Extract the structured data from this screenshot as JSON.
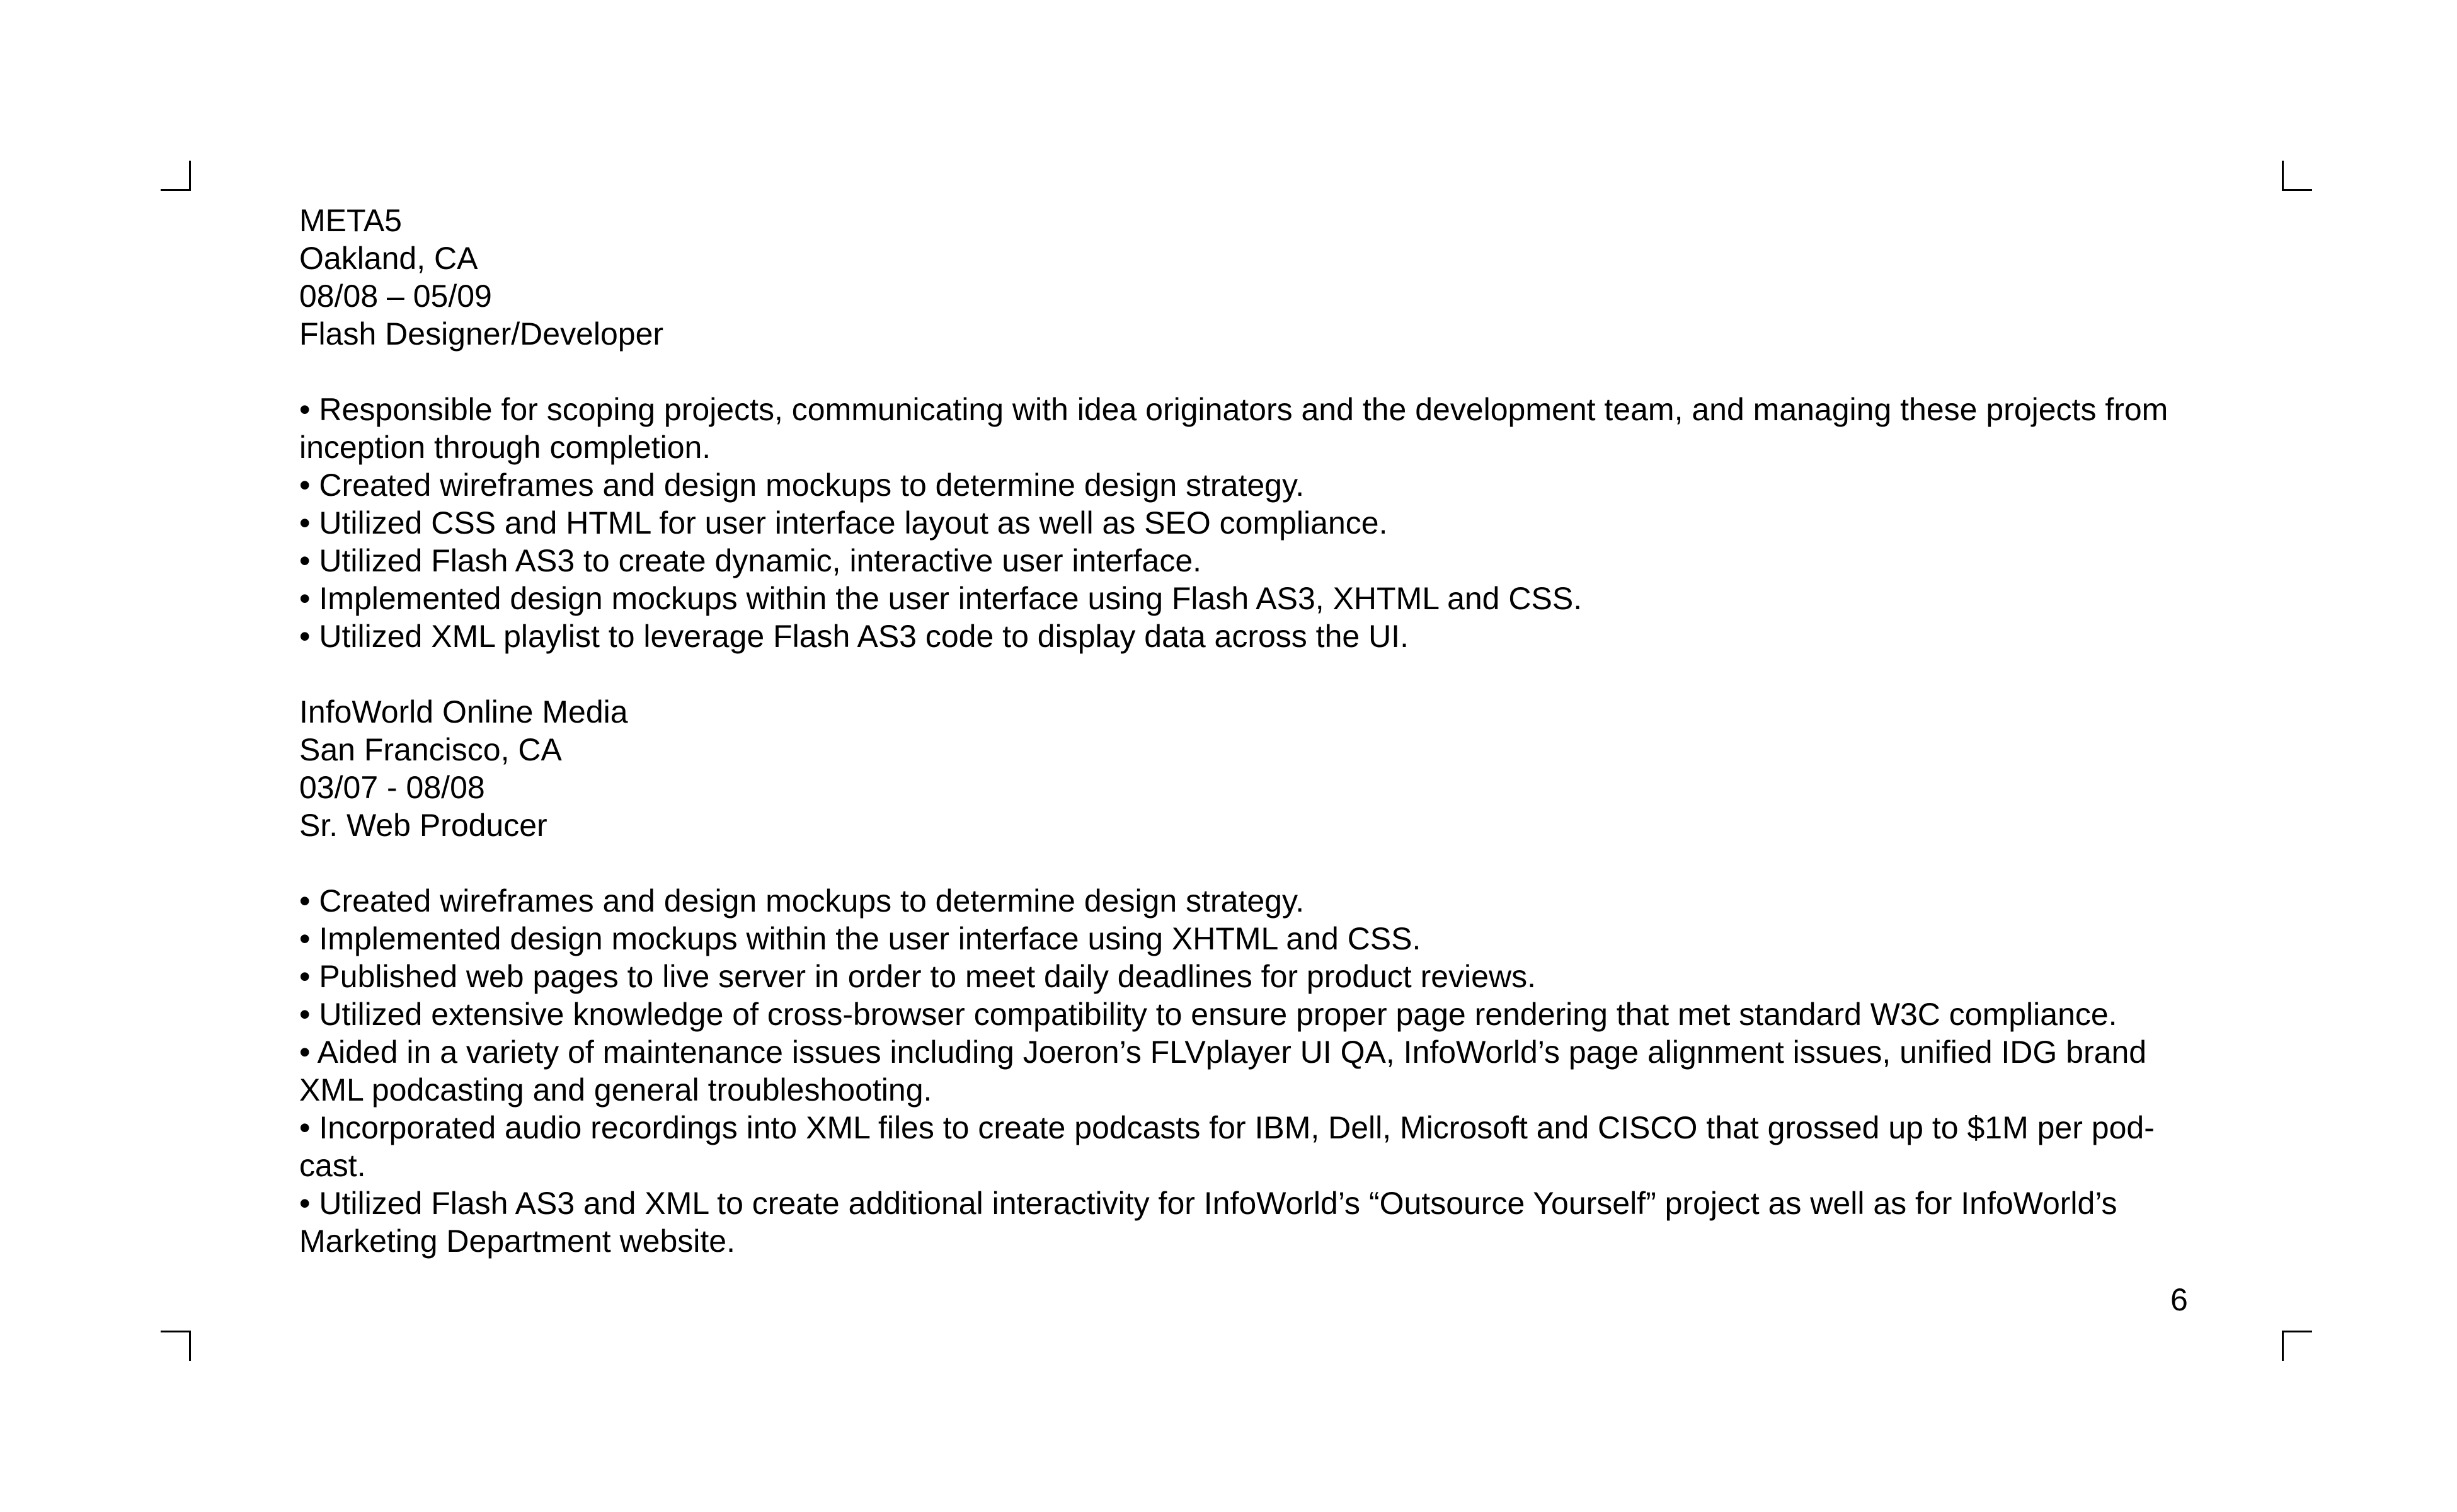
{
  "jobs": [
    {
      "company": "META5",
      "location": "Oakland, CA",
      "dates": "08/08 – 05/09",
      "title": "Flash Designer/Developer",
      "bullets": [
        "• Responsible for scoping projects, communicating with idea originators and the development team, and managing these projects from inception through completion.",
        "• Created wireframes and design mockups to determine design strategy.",
        "• Utilized CSS and HTML for user interface layout as well as SEO compliance.",
        "• Utilized Flash AS3 to create dynamic, interactive user interface.",
        "• Implemented design mockups within the user interface using Flash AS3, XHTML and CSS.",
        "• Utilized XML playlist to leverage Flash AS3 code to display data across the UI."
      ]
    },
    {
      "company": "InfoWorld Online Media",
      "location": "San Francisco, CA",
      "dates": "03/07 - 08/08",
      "title": "Sr. Web Producer",
      "bullets": [
        "• Created wireframes and design mockups to determine design strategy.",
        "• Implemented design mockups within the user interface using XHTML and CSS.",
        "• Published web pages to live server in order to meet daily deadlines for product reviews.",
        "• Utilized extensive knowledge of cross-browser compatibility to ensure proper page rendering that met standard W3C compliance.",
        "• Aided in a variety of maintenance issues including Joeron’s FLVplayer UI QA, InfoWorld’s page alignment issues, unified IDG brand XML podcasting and general troubleshooting.",
        "• Incorporated audio recordings into XML files to create podcasts for IBM, Dell, Microsoft and CISCO that grossed up to $1M per pod-cast.",
        "• Utilized Flash AS3 and XML to create additional interactivity for InfoWorld’s “Outsource Yourself” project as well as for InfoWorld’s Marketing Department website."
      ]
    }
  ],
  "page_number": "6"
}
